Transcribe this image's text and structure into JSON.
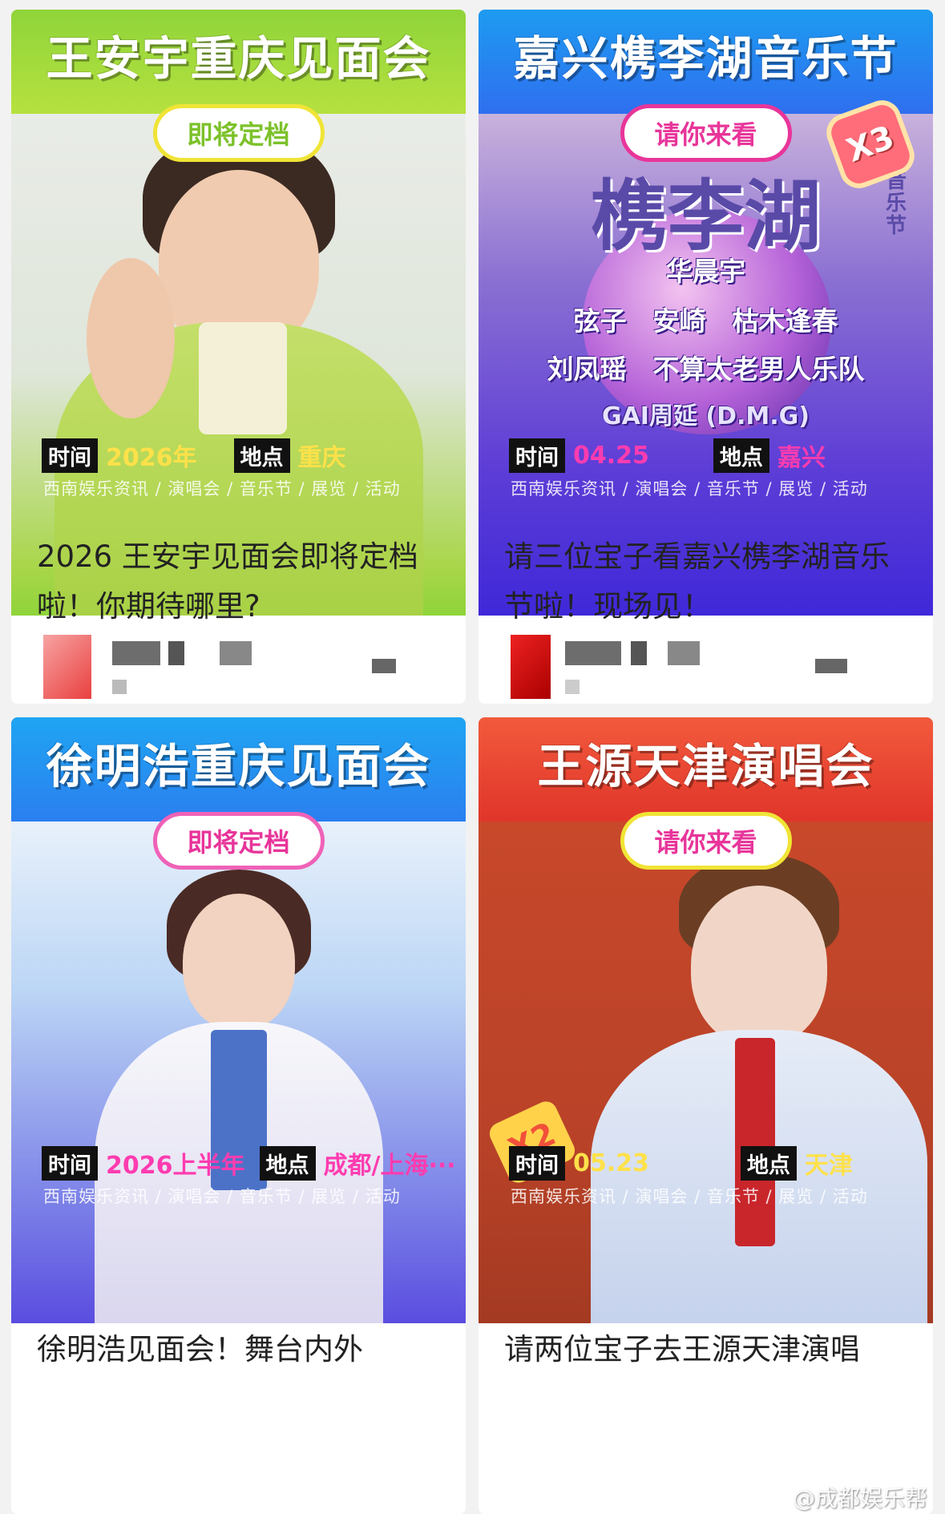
{
  "cards": [
    {
      "title": "王安宇重庆见面会",
      "pill": "即将定档",
      "time_label": "时间",
      "time_value": "2026年",
      "place_label": "地点",
      "place_value": "重庆",
      "categories": "西南娱乐资讯 / 演唱会 / 音乐节 / 展览 / 活动",
      "caption": "2026 王安宇见面会即将定档啦！你期待哪里?"
    },
    {
      "title": "嘉兴槜李湖音乐节",
      "pill": "请你来看",
      "badge": "X3",
      "festival_logo": "槜李湖",
      "festival_logo_sub": "音乐节",
      "lineup": [
        "华晨宇",
        "弦子　安崎　枯木逢春",
        "刘凤瑶　不算太老男人乐队",
        "GAI周延 (D.M.G)"
      ],
      "time_label": "时间",
      "time_value": "04.25",
      "place_label": "地点",
      "place_value": "嘉兴",
      "categories": "西南娱乐资讯 / 演唱会 / 音乐节 / 展览 / 活动",
      "caption": "请三位宝子看嘉兴槜李湖音乐节啦！现场见！"
    },
    {
      "title": "徐明浩重庆见面会",
      "pill": "即将定档",
      "time_label": "时间",
      "time_value": "2026上半年",
      "place_label": "地点",
      "place_value": "成都/上海···",
      "categories": "西南娱乐资讯 / 演唱会 / 音乐节 / 展览 / 活动",
      "caption": "徐明浩见面会！舞台内外"
    },
    {
      "title": "王源天津演唱会",
      "pill": "请你来看",
      "badge": "X2",
      "time_label": "时间",
      "time_value": "05.23",
      "place_label": "地点",
      "place_value": "天津",
      "categories": "西南娱乐资讯 / 演唱会 / 音乐节 / 展览 / 活动",
      "caption": "请两位宝子去王源天津演唱"
    }
  ],
  "watermark": "@成都娱乐帮",
  "colors": {
    "green": "#8fd43a",
    "blue": "#2f6ff0",
    "magenta": "#e8359a",
    "red": "#e0352a",
    "yellow": "#ffe14a"
  }
}
